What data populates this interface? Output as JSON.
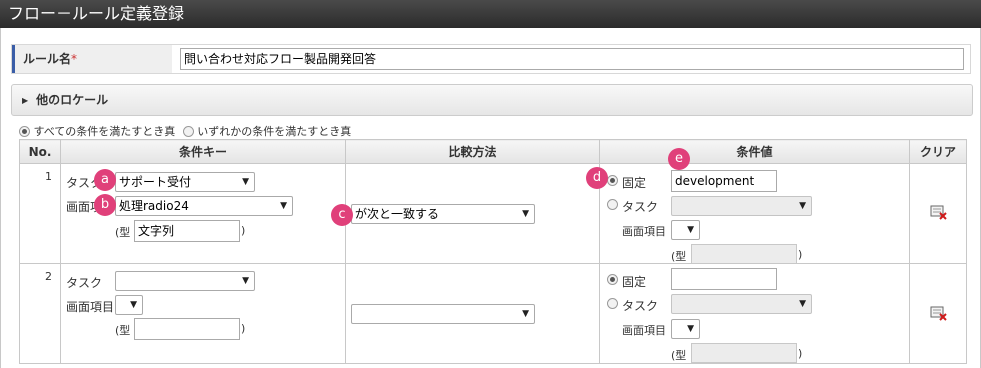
{
  "window": {
    "title": "フロー－ルール定義登録"
  },
  "rule_name": {
    "label": "ルール名",
    "required_mark": "*",
    "value": "問い合わせ対応フロー製品開発回答"
  },
  "locale_section": {
    "label": "他のロケール"
  },
  "condition_mode": {
    "options": [
      "すべての条件を満たすとき真",
      "いずれかの条件を満たすとき真"
    ],
    "selected": "すべての条件を満たすとき真"
  },
  "table": {
    "headers": {
      "no": "No.",
      "key": "条件キー",
      "method": "比較方法",
      "value": "条件値",
      "clear": "クリア"
    },
    "rows": [
      {
        "no": "1",
        "task_label": "タスク",
        "task_value": "サポート受付",
        "item_label": "画面項目",
        "item_value": "処理radio24",
        "type_open": "(型",
        "type_value": "文字列",
        "type_close": ")",
        "method_value": "が次と一致する",
        "fixed_label": "固定",
        "fixed_value": "development",
        "vtask_label": "タスク",
        "vtask_value": "",
        "vitem_label": "画面項目",
        "vitem_value": "",
        "vtype_open": "(型",
        "vtype_close": ")"
      },
      {
        "no": "2",
        "task_label": "タスク",
        "task_value": "",
        "item_label": "画面項目",
        "item_value": "",
        "type_open": "(型",
        "type_value": "",
        "type_close": ")",
        "method_value": "",
        "fixed_label": "固定",
        "fixed_value": "",
        "vtask_label": "タスク",
        "vtask_value": "",
        "vitem_label": "画面項目",
        "vitem_value": "",
        "vtype_open": "(型",
        "vtype_close": ")"
      }
    ]
  },
  "callouts": {
    "a": "a",
    "b": "b",
    "c": "c",
    "d": "d",
    "e": "e"
  },
  "icons": {
    "dropdown": "▼",
    "collapse": "▶",
    "clear": "clear-icon"
  },
  "colors": {
    "callout": "#e0407a",
    "accent": "#3a5da7"
  }
}
